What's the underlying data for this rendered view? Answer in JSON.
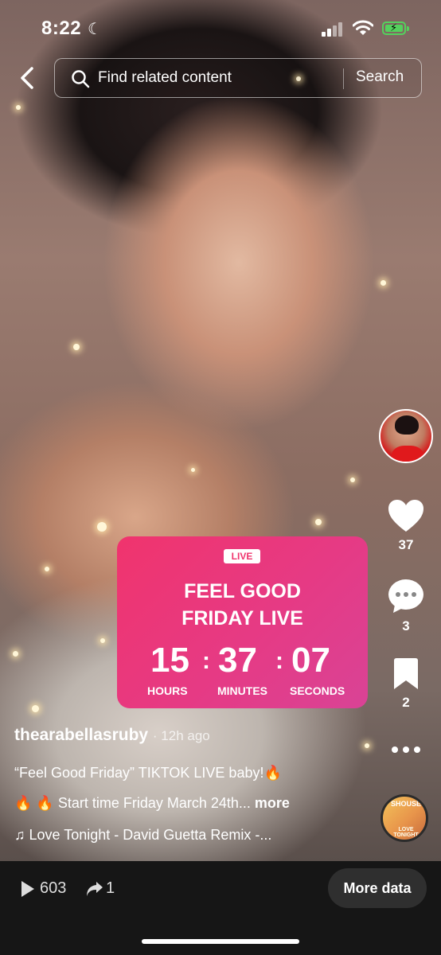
{
  "status_bar": {
    "time": "8:22"
  },
  "search": {
    "placeholder": "Find related content",
    "button_label": "Search"
  },
  "live_card": {
    "badge": "LIVE",
    "title_line1": "FEEL GOOD",
    "title_line2": "FRIDAY LIVE",
    "hours": "15",
    "minutes": "37",
    "seconds": "07",
    "hours_label": "HOURS",
    "minutes_label": "MINUTES",
    "seconds_label": "SECONDS",
    "colors": {
      "gradient_start": "#f0346d",
      "gradient_end": "#d94396"
    }
  },
  "actions": {
    "likes": "37",
    "comments": "3",
    "saves": "2"
  },
  "post": {
    "username": "thearabellasruby",
    "time_ago": "· 12h ago",
    "description_line1": "“Feel Good Friday” TIKTOK LIVE baby!🔥",
    "description_line2": "🔥 🔥 Start time Friday March 24th...",
    "more_label": "more",
    "music": "Love Tonight - David Guetta Remix -...",
    "disc_text": "SHOUSE",
    "disc_subtext": "LOVE TONIGHT"
  },
  "bottom_bar": {
    "views": "603",
    "shares": "1",
    "more_data_label": "More data"
  }
}
